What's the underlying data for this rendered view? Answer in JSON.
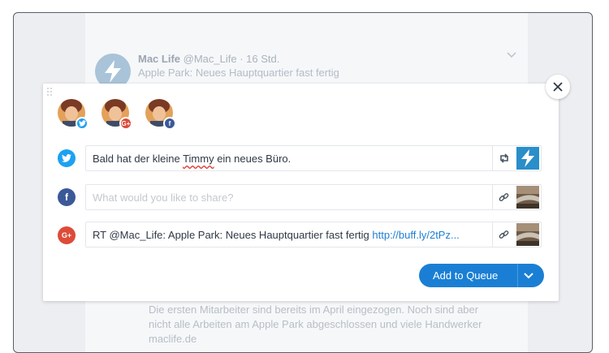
{
  "background": {
    "tweet": {
      "name": "Mac Life",
      "handle": "@Mac_Life",
      "time": "16 Std.",
      "text": "Apple Park: Neues Hauptquartier fast fertig"
    },
    "paragraph": [
      "Die ersten Mitarbeiter sind bereits im April eingezogen. Noch sind aber",
      "nicht alle Arbeiten am Apple Park abgeschlossen und viele Handwerker",
      "maclife.de"
    ]
  },
  "composer": {
    "profiles": [
      {
        "network": "twitter",
        "badge_icon": "twitter-bird-icon"
      },
      {
        "network": "google-plus",
        "badge_icon": "google-plus-icon",
        "badge_text": "G+"
      },
      {
        "network": "facebook",
        "badge_icon": "facebook-f-icon",
        "badge_text": "f"
      }
    ],
    "rows": [
      {
        "network": "twitter",
        "icon": "twitter-bird-icon",
        "text_before": "Bald hat der kleine ",
        "text_misspelled": "Timmy",
        "text_after": " ein neues Büro.",
        "tool_icon": "retweet-icon"
      },
      {
        "network": "facebook",
        "icon": "facebook-f-icon",
        "icon_text": "f",
        "placeholder": "What would you like to share?",
        "tool_icon": "link-icon"
      },
      {
        "network": "google-plus",
        "icon": "google-plus-icon",
        "icon_text": "G+",
        "text": "RT @Mac_Life: Apple Park: Neues Hauptquartier fast fertig ",
        "link": "http://buff.ly/2tPz...",
        "tool_icon": "link-icon"
      }
    ],
    "add_button_label": "Add to Queue"
  },
  "colors": {
    "twitter": "#1da1f2",
    "facebook": "#3b5998",
    "google_plus": "#dd4b39",
    "primary": "#1a7fd4"
  }
}
